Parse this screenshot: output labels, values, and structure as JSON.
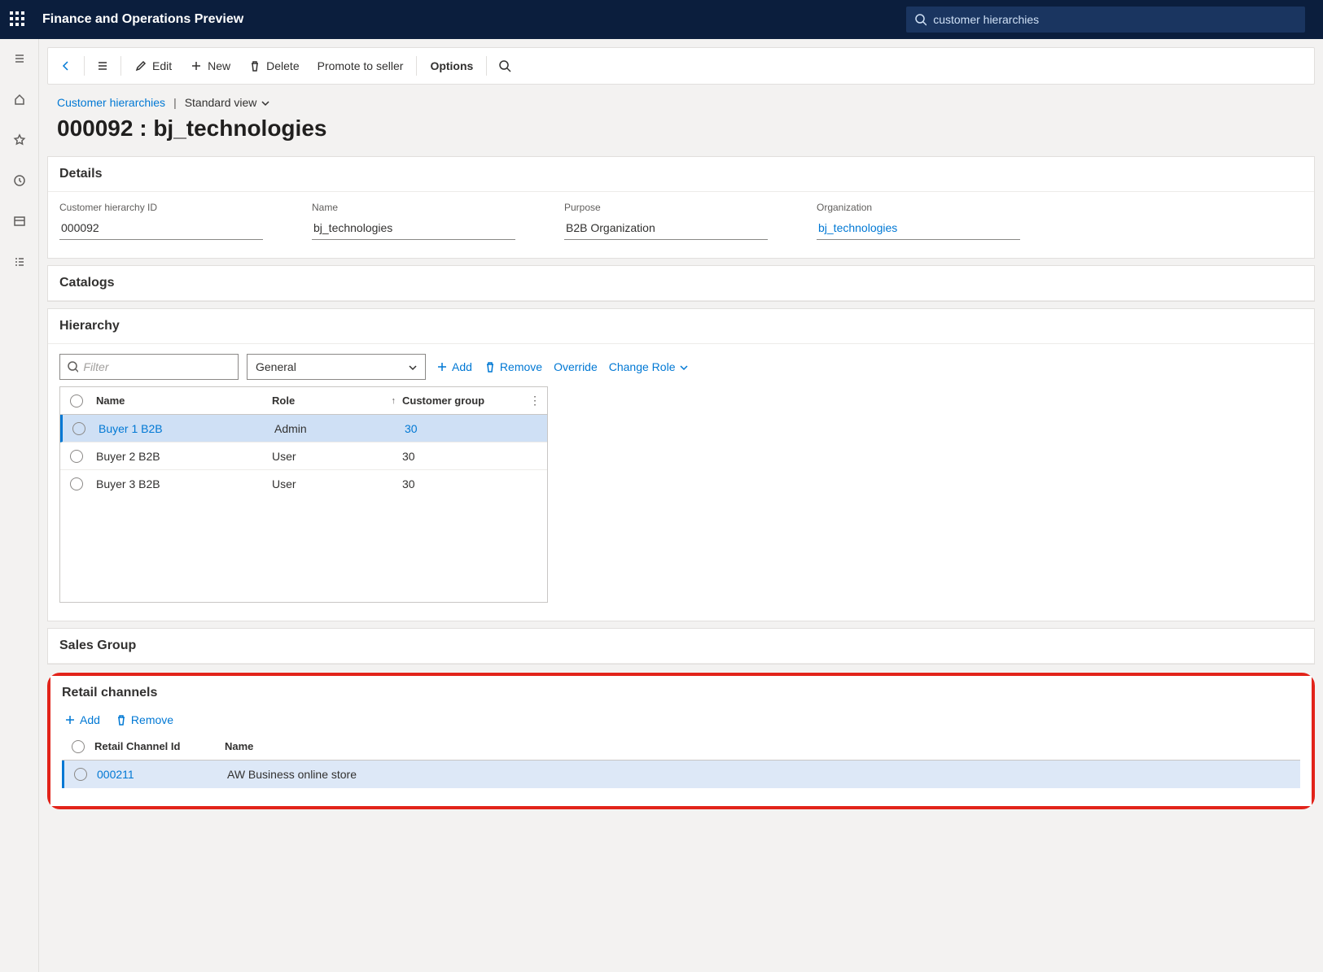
{
  "app": {
    "title": "Finance and Operations Preview"
  },
  "search": {
    "value": "customer hierarchies"
  },
  "commandBar": {
    "edit": "Edit",
    "new": "New",
    "delete": "Delete",
    "promote": "Promote to seller",
    "options": "Options"
  },
  "breadcrumb": {
    "link": "Customer hierarchies",
    "view": "Standard view"
  },
  "pageTitle": "000092 : bj_technologies",
  "details": {
    "header": "Details",
    "idLabel": "Customer hierarchy ID",
    "idValue": "000092",
    "nameLabel": "Name",
    "nameValue": "bj_technologies",
    "purposeLabel": "Purpose",
    "purposeValue": "B2B Organization",
    "orgLabel": "Organization",
    "orgValue": "bj_technologies"
  },
  "catalogs": {
    "header": "Catalogs"
  },
  "hierarchy": {
    "header": "Hierarchy",
    "filterPlaceholder": "Filter",
    "selectValue": "General",
    "add": "Add",
    "remove": "Remove",
    "override": "Override",
    "changeRole": "Change Role",
    "columns": {
      "name": "Name",
      "role": "Role",
      "group": "Customer group"
    },
    "rows": [
      {
        "name": "Buyer 1 B2B",
        "role": "Admin",
        "group": "30",
        "selected": true
      },
      {
        "name": "Buyer 2 B2B",
        "role": "User",
        "group": "30",
        "selected": false
      },
      {
        "name": "Buyer 3 B2B",
        "role": "User",
        "group": "30",
        "selected": false
      }
    ]
  },
  "salesGroup": {
    "header": "Sales Group"
  },
  "retail": {
    "header": "Retail channels",
    "add": "Add",
    "remove": "Remove",
    "columns": {
      "id": "Retail Channel Id",
      "name": "Name"
    },
    "rows": [
      {
        "id": "000211",
        "name": "AW Business online store",
        "selected": true
      }
    ]
  }
}
